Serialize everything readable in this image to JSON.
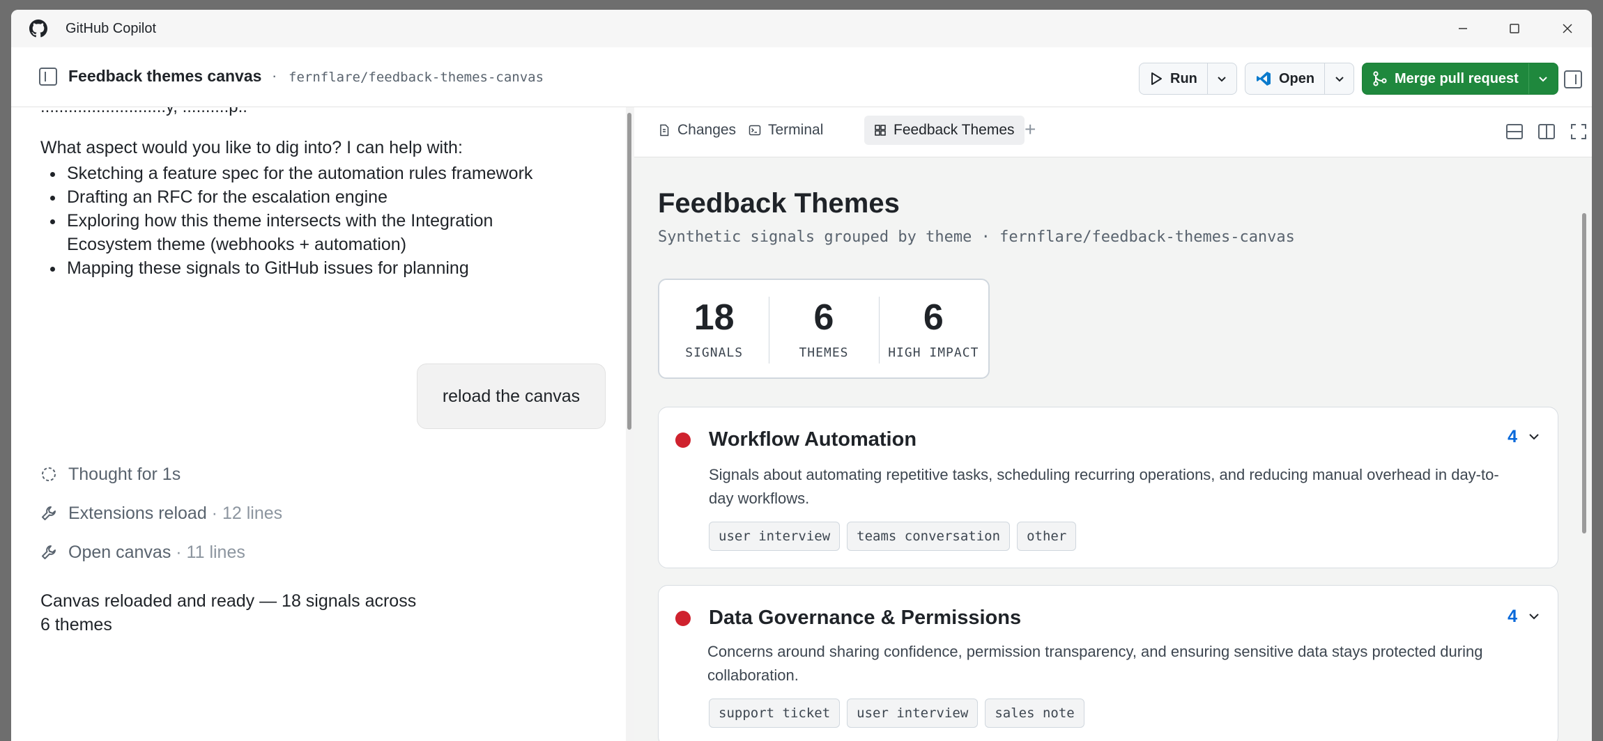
{
  "window": {
    "app_title": "GitHub Copilot"
  },
  "header": {
    "title": "Feedback themes canvas",
    "separator": "·",
    "repo": "fernflare/feedback-themes-canvas",
    "run_label": "Run",
    "open_label": "Open",
    "merge_label": "Merge pull request"
  },
  "chat": {
    "cut_text": "...........................y, ..........p..",
    "intro": "What aspect would you like to dig into? I can help with:",
    "bullets": [
      "Sketching a feature spec for the automation rules framework",
      "Drafting an RFC for the escalation engine",
      "Exploring how this theme intersects with the Integration Ecosystem theme (webhooks + automation)",
      "Mapping these signals to GitHub issues for planning"
    ],
    "user_message": "reload the canvas",
    "steps": [
      {
        "label": "Thought for 1s",
        "detail": ""
      },
      {
        "label": "Extensions reload",
        "detail": " · 12 lines"
      },
      {
        "label": "Open canvas",
        "detail": " · 11 lines"
      }
    ],
    "final": "Canvas reloaded and ready — 18 signals across 6 themes"
  },
  "tabs": [
    {
      "label": "Changes",
      "icon": "file-diff-icon"
    },
    {
      "label": "Terminal",
      "icon": "terminal-icon"
    },
    {
      "label": "Feedback Themes",
      "icon": "canvas-icon",
      "active": true
    }
  ],
  "canvas": {
    "title": "Feedback Themes",
    "subtitle": "Synthetic signals grouped by theme · fernflare/feedback-themes-canvas",
    "stats": [
      {
        "value": "18",
        "label": "SIGNALS"
      },
      {
        "value": "6",
        "label": "THEMES"
      },
      {
        "value": "6",
        "label": "HIGH IMPACT"
      }
    ],
    "themes": [
      {
        "name": "Workflow Automation",
        "count": "4",
        "color": "#cf222e",
        "description": "Signals about automating repetitive tasks, scheduling recurring operations, and reducing manual overhead in day-to-day workflows.",
        "tags": [
          "user interview",
          "teams conversation",
          "other"
        ]
      },
      {
        "name": "Data Governance & Permissions",
        "count": "4",
        "color": "#cf222e",
        "description": "Concerns around sharing confidence, permission transparency, and ensuring sensitive data stays protected during collaboration.",
        "tags": [
          "support ticket",
          "user interview",
          "sales note"
        ]
      }
    ]
  },
  "colors": {
    "accent_green": "#1f883d",
    "impact_red": "#cf222e",
    "link_blue": "#0969da"
  }
}
